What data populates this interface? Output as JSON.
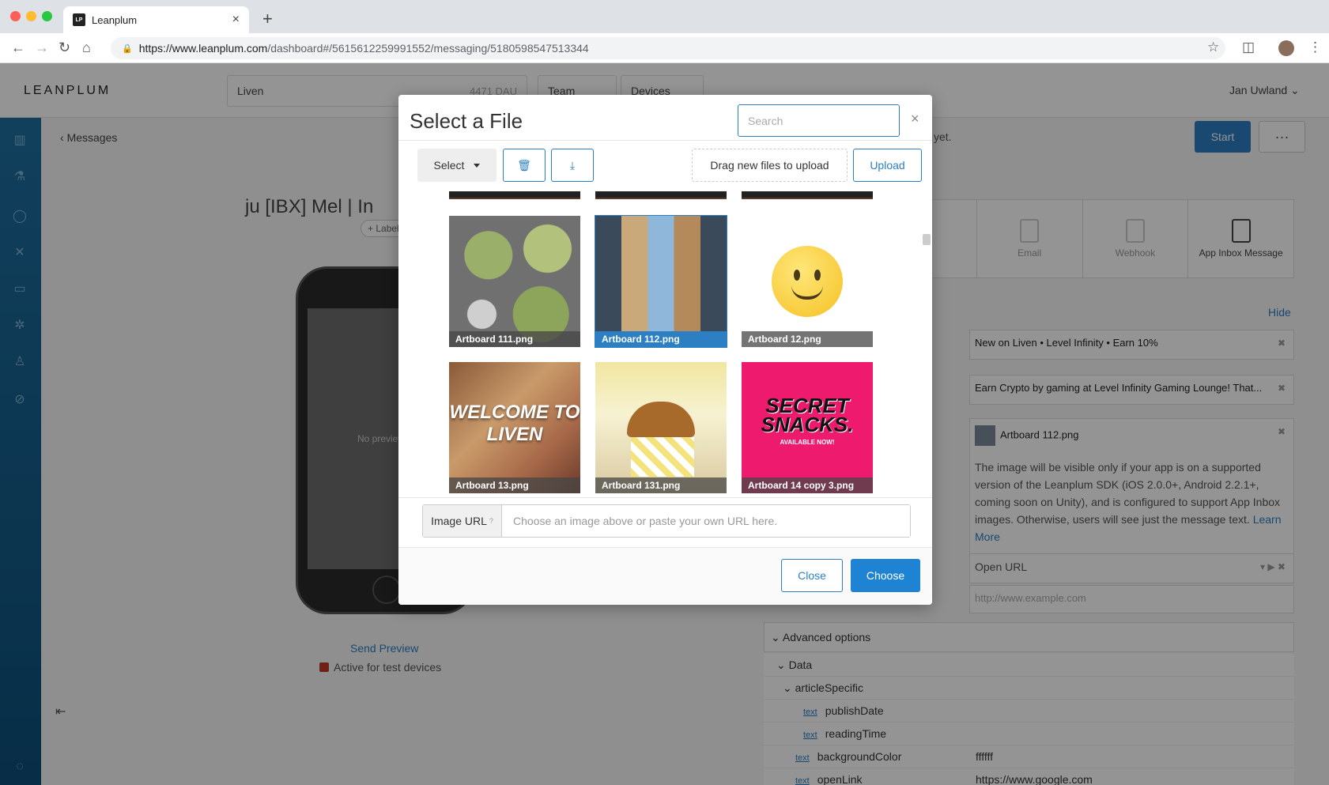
{
  "browser": {
    "tab_title": "Leanplum",
    "tab_favicon": "LP",
    "url_host": "https://www.leanplum.com",
    "url_path": "/dashboard#/5615612259991552/messaging/5180598547513344"
  },
  "app": {
    "logo": "LEANPLUM",
    "app_name": "Liven",
    "dau": "4471 DAU",
    "team_label": "Team",
    "devices_label": "Devices",
    "user_name": "Jan Uwland",
    "messages_link": "Messages",
    "message_title": "ju [IBX] Mel | In",
    "label_chip": "+ Label",
    "no_preview": "No preview a",
    "send_preview": "Send Preview",
    "active_test": "Active for test devices",
    "partial_status": "yet.",
    "start_button": "Start",
    "more_button": "···",
    "message_types": [
      {
        "label": "Email",
        "icon": "email-icon"
      },
      {
        "label": "Webhook",
        "icon": "webhook-icon"
      },
      {
        "label": "App Inbox Message",
        "icon": "app-inbox-icon"
      }
    ],
    "hide_link": "Hide",
    "fields": {
      "title": "New on Liven • Level Infinity • Earn 10%",
      "subtitle": "Earn Crypto by gaming at Level Infinity Gaming Lounge! That...",
      "image": "Artboard 112.png",
      "image_note": "The image will be visible only if your app is on a supported version of the Leanplum SDK (iOS 2.0.0+, Android 2.2.1+, coming soon on Unity), and is configured to support App Inbox images. Otherwise, users will see just the message text.",
      "learn_more": "Learn More",
      "action": "Open URL",
      "url_placeholder": "http://www.example.com"
    },
    "advanced": {
      "title": "Advanced options",
      "data_label": "Data",
      "rows": [
        {
          "indent": 1,
          "tag": "",
          "key": "articleSpecific",
          "value": ""
        },
        {
          "indent": 2,
          "tag": "text",
          "key": "publishDate",
          "value": ""
        },
        {
          "indent": 2,
          "tag": "text",
          "key": "readingTime",
          "value": ""
        },
        {
          "indent": 1,
          "tag": "text",
          "key": "backgroundColor",
          "value": "ffffff"
        },
        {
          "indent": 1,
          "tag": "text",
          "key": "openLink",
          "value": "https://www.google.com"
        }
      ]
    }
  },
  "modal": {
    "title": "Select a File",
    "search_placeholder": "Search",
    "close_x": "×",
    "select_button": "Select",
    "drag_text": "Drag new files to upload",
    "upload_button": "Upload",
    "files": [
      {
        "name": "Artboard 111.png",
        "selected": false
      },
      {
        "name": "Artboard 112.png",
        "selected": true
      },
      {
        "name": "Artboard 12.png",
        "selected": false
      },
      {
        "name": "Artboard 13.png",
        "selected": false
      },
      {
        "name": "Artboard 131.png",
        "selected": false
      },
      {
        "name": "Artboard 14 copy 3.png",
        "selected": false
      }
    ],
    "welcome_text": "WELCOME TO LIVEN",
    "snacks_text": "SECRET SNACKS.",
    "snacks_sub": "AVAILABLE NOW!",
    "image_url_label": "Image URL",
    "image_url_help": "?",
    "image_url_placeholder": "Choose an image above or paste your own URL here.",
    "close_button": "Close",
    "choose_button": "Choose"
  }
}
